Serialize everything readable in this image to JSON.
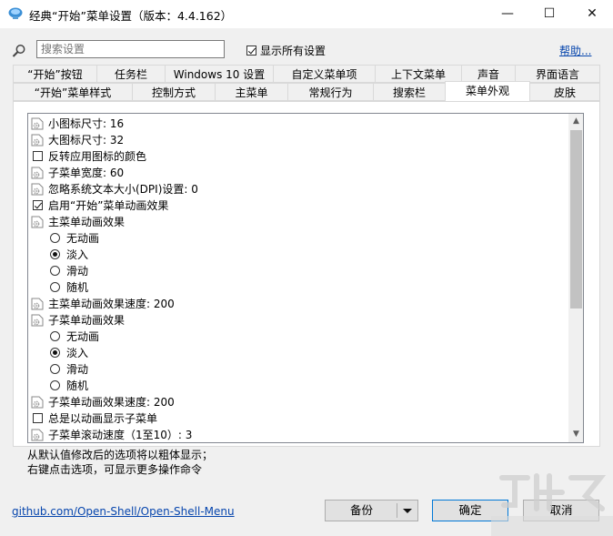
{
  "window": {
    "title": "经典“开始”菜单设置（版本：4.4.162）",
    "minimize_glyph": "—",
    "maximize_glyph": "☐",
    "close_glyph": "✕"
  },
  "search": {
    "placeholder": "搜索设置",
    "value": ""
  },
  "show_all": {
    "label": "显示所有设置",
    "checked": true
  },
  "help_label": "帮助...",
  "tabs_row1": [
    "“开始”按钮",
    "任务栏",
    "Windows 10 设置",
    "自定义菜单项",
    "上下文菜单",
    "声音",
    "界面语言"
  ],
  "tabs_row2": [
    "“开始”菜单样式",
    "控制方式",
    "主菜单",
    "常规行为",
    "搜索栏",
    "菜单外观",
    "皮肤"
  ],
  "active_tab": "菜单外观",
  "settings": [
    {
      "kind": "value",
      "text": "小图标尺寸: 16"
    },
    {
      "kind": "value",
      "text": "大图标尺寸: 32"
    },
    {
      "kind": "check",
      "text": "反转应用图标的颜色",
      "checked": false
    },
    {
      "kind": "value",
      "text": "子菜单宽度: 60"
    },
    {
      "kind": "value",
      "text": "忽略系统文本大小(DPI)设置: 0"
    },
    {
      "kind": "check",
      "text": "启用“开始”菜单动画效果",
      "checked": true
    },
    {
      "kind": "group",
      "text": "主菜单动画效果"
    },
    {
      "kind": "radio",
      "text": "无动画",
      "checked": false
    },
    {
      "kind": "radio",
      "text": "淡入",
      "checked": true
    },
    {
      "kind": "radio",
      "text": "滑动",
      "checked": false
    },
    {
      "kind": "radio",
      "text": "随机",
      "checked": false
    },
    {
      "kind": "value",
      "text": "主菜单动画效果速度: 200"
    },
    {
      "kind": "group",
      "text": "子菜单动画效果"
    },
    {
      "kind": "radio",
      "text": "无动画",
      "checked": false
    },
    {
      "kind": "radio",
      "text": "淡入",
      "checked": true
    },
    {
      "kind": "radio",
      "text": "滑动",
      "checked": false
    },
    {
      "kind": "radio",
      "text": "随机",
      "checked": false
    },
    {
      "kind": "value",
      "text": "子菜单动画效果速度: 200"
    },
    {
      "kind": "check",
      "text": "总是以动画显示子菜单",
      "checked": false
    },
    {
      "kind": "value",
      "text": "子菜单滚动速度（1至10）: 3"
    }
  ],
  "footnote_lines": [
    "从默认值修改后的选项将以粗体显示；",
    "右键点击选项，可显示更多操作命令"
  ],
  "github_link": "github.com/Open-Shell/Open-Shell-Menu",
  "buttons": {
    "backup": "备份",
    "ok": "确定",
    "cancel": "取消"
  },
  "colors": {
    "link": "#0645ad",
    "accent": "#0078d7"
  },
  "icons": {
    "app": "shell-icon",
    "search": "magnifier-icon",
    "setting": "gear-document-icon",
    "scroll_up": "▲",
    "scroll_down": "▼"
  }
}
